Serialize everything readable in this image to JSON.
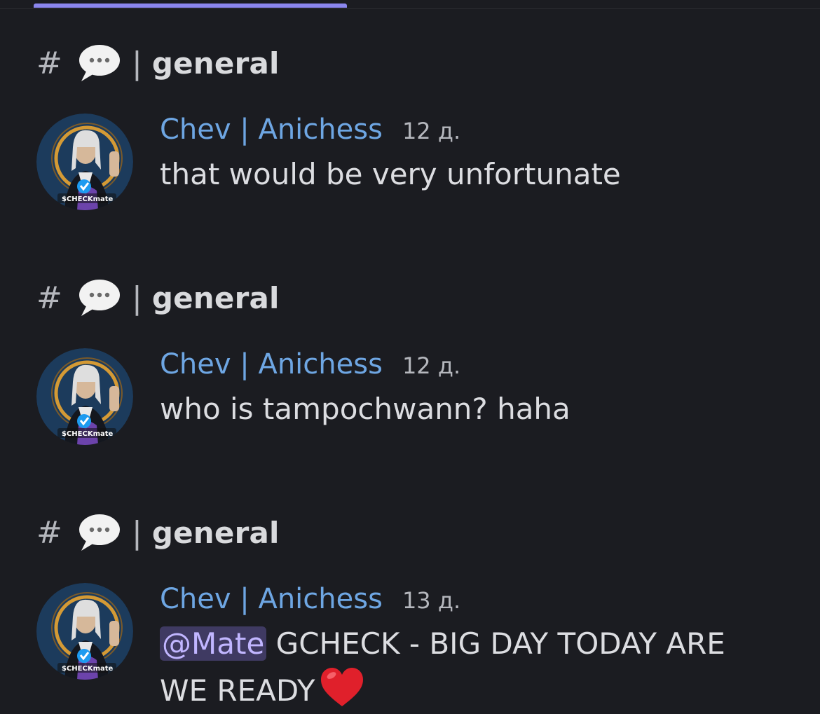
{
  "channel": {
    "hash": "#",
    "separator": "|",
    "name": "general"
  },
  "messages": [
    {
      "author": "Chev | Anichess",
      "time": "12 д.",
      "text": "that would be very unfortunate",
      "avatar_caption": "$CHECKmate"
    },
    {
      "author": "Chev | Anichess",
      "time": "12 д.",
      "text": "who is tampochwann? haha",
      "avatar_caption": "$CHECKmate"
    },
    {
      "author": "Chev | Anichess",
      "time": "13 д.",
      "mention": "@Mate",
      "text_line1": " GCHECK - BIG DAY TODAY ARE",
      "text_line2": "WE READY",
      "avatar_caption": "$CHECKmate"
    }
  ],
  "colors": {
    "background": "#1b1c21",
    "username": "#6ea6e3",
    "accent": "#8b86ee",
    "mention_bg": "#3f3a62"
  },
  "icons": [
    "speech-bubble-icon",
    "heart-emoji-icon",
    "verified-badge-icon"
  ]
}
